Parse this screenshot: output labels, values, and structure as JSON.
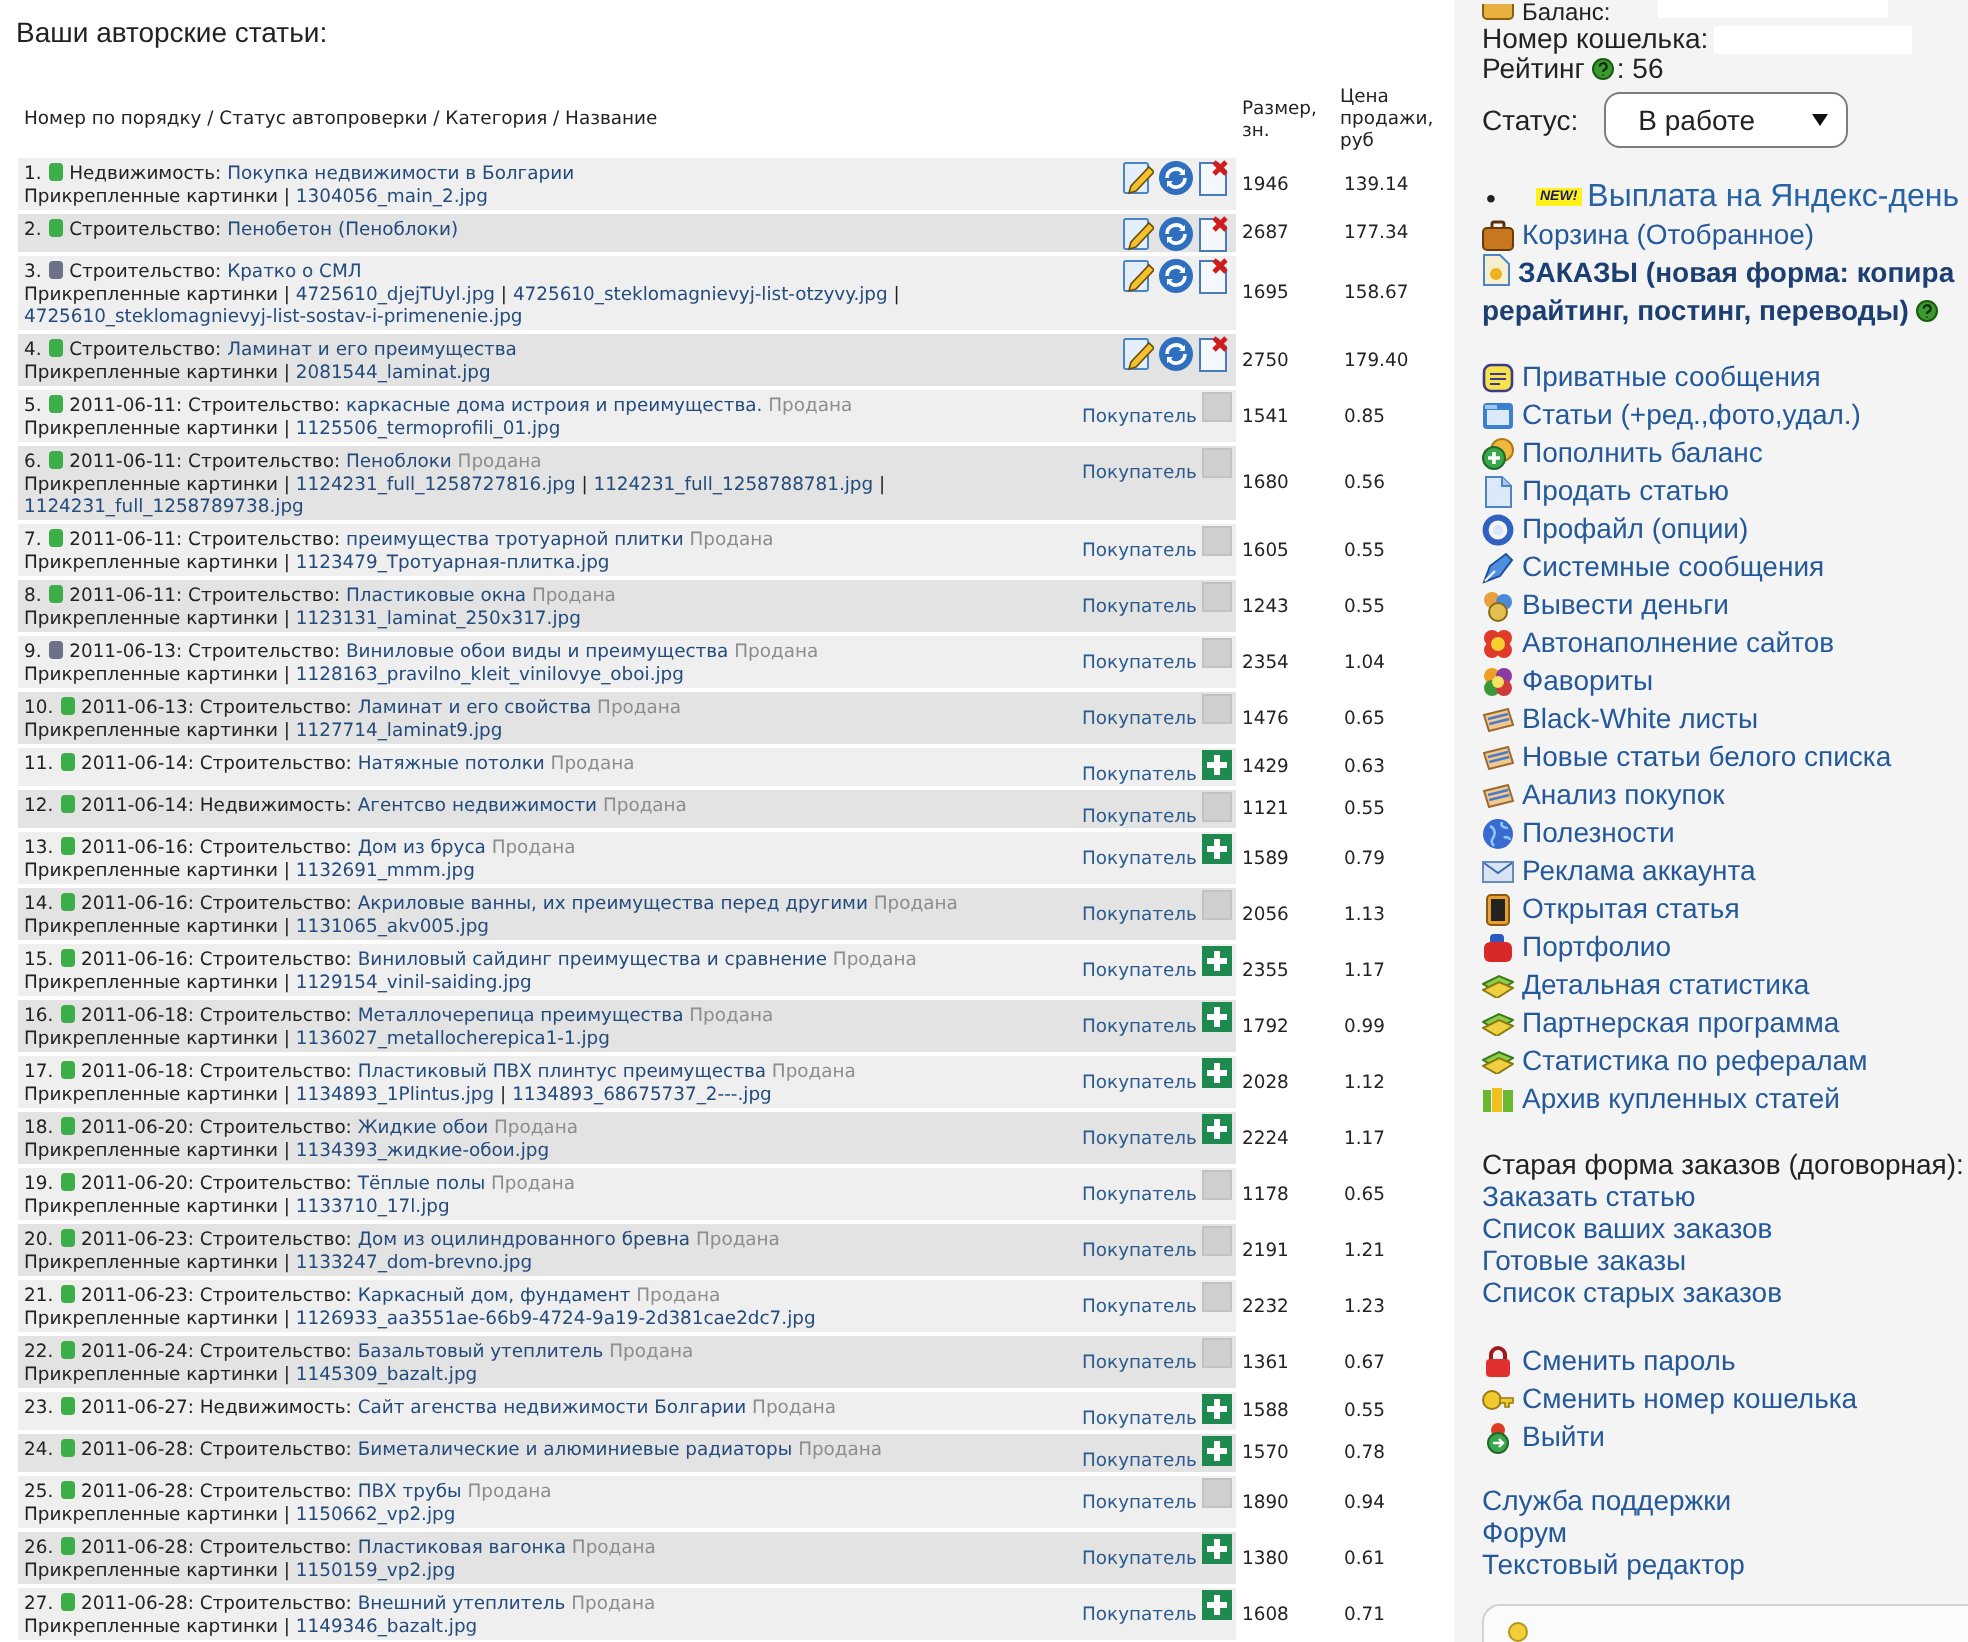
{
  "page_title": "Ваши авторские статьи:",
  "table": {
    "columns": [
      "Номер по порядку / Статус автопроверки / Категория / Название",
      "Размер, зн.",
      "Цена продажи, руб"
    ],
    "rows": [
      {
        "number": "1.",
        "color": "#3cae48",
        "kind": "own",
        "category": "Недвижимость:",
        "title": "Покупка недвижимости в Болгарии",
        "attachments": {
          "label": "Прикрепленные картинки |",
          "files": [
            {
              "name": "1304056_main_2.jpg"
            }
          ]
        },
        "size": "1946",
        "price": "139.14"
      },
      {
        "number": "2.",
        "color": "#3cae48",
        "kind": "own",
        "category": "Строительство:",
        "title": "Пенобетон (Пеноблоки)",
        "size": "2687",
        "price": "177.34"
      },
      {
        "number": "3.",
        "color": "#6d7288",
        "kind": "own",
        "category": "Строительство:",
        "title": "Кратко о СМЛ",
        "attachments": {
          "label": "Прикрепленные картинки |",
          "files": [
            {
              "name": "4725610_djejTUyl.jpg",
              "separator": "|"
            },
            {
              "name": "4725610_steklomagnievyj-list-otzyvy.jpg",
              "separator": "|"
            },
            {
              "name": "4725610_steklomagnievyj-list-sostav-i-primenenie.jpg"
            }
          ]
        },
        "size": "1695",
        "price": "158.67"
      },
      {
        "number": "4.",
        "color": "#3cae48",
        "kind": "own",
        "category": "Строительство:",
        "title": "Ламинат и его преимущества",
        "attachments": {
          "label": "Прикрепленные картинки |",
          "files": [
            {
              "name": "2081544_laminat.jpg"
            }
          ]
        },
        "size": "2750",
        "price": "179.40"
      },
      {
        "number": "5.",
        "color": "#3cae48",
        "kind": "sold",
        "date": "2011-06-11:",
        "category": "Строительство:",
        "title": "каркасные дома истроия и преимущества.",
        "sale_status": "Продана",
        "attachments": {
          "label": "Прикрепленные картинки |",
          "files": [
            {
              "name": "1125506_termoprofili_01.jpg"
            }
          ]
        },
        "buyer": "Покупатель",
        "plus": false,
        "size": "1541",
        "price": "0.85"
      },
      {
        "number": "6.",
        "color": "#3cae48",
        "kind": "sold",
        "date": "2011-06-11:",
        "category": "Строительство:",
        "title": "Пеноблоки",
        "sale_status": "Продана",
        "attachments": {
          "label": "Прикрепленные картинки |",
          "files": [
            {
              "name": "1124231_full_1258727816.jpg",
              "separator": "|"
            },
            {
              "name": "1124231_full_1258788781.jpg",
              "separator": "|"
            },
            {
              "name": "1124231_full_1258789738.jpg"
            }
          ]
        },
        "buyer": "Покупатель",
        "plus": false,
        "size": "1680",
        "price": "0.56"
      },
      {
        "number": "7.",
        "color": "#3cae48",
        "kind": "sold",
        "date": "2011-06-11:",
        "category": "Строительство:",
        "title": "преимущества тротуарной плитки",
        "sale_status": "Продана",
        "attachments": {
          "label": "Прикрепленные картинки |",
          "files": [
            {
              "name": "1123479_Тротуарная-плитка.jpg"
            }
          ]
        },
        "buyer": "Покупатель",
        "plus": false,
        "size": "1605",
        "price": "0.55"
      },
      {
        "number": "8.",
        "color": "#3cae48",
        "kind": "sold",
        "date": "2011-06-11:",
        "category": "Строительство:",
        "title": "Пластиковые окна",
        "sale_status": "Продана",
        "attachments": {
          "label": "Прикрепленные картинки |",
          "files": [
            {
              "name": "1123131_laminat_250x317.jpg"
            }
          ]
        },
        "buyer": "Покупатель",
        "plus": false,
        "size": "1243",
        "price": "0.55"
      },
      {
        "number": "9.",
        "color": "#6d7288",
        "kind": "sold",
        "date": "2011-06-13:",
        "category": "Строительство:",
        "title": "Виниловые обои виды и преимущества",
        "sale_status": "Продана",
        "attachments": {
          "label": "Прикрепленные картинки |",
          "files": [
            {
              "name": "1128163_pravilno_kleit_vinilovye_oboi.jpg"
            }
          ]
        },
        "buyer": "Покупатель",
        "plus": false,
        "size": "2354",
        "price": "1.04"
      },
      {
        "number": "10.",
        "color": "#3cae48",
        "kind": "sold",
        "date": "2011-06-13:",
        "category": "Строительство:",
        "title": "Ламинат и его свойства",
        "sale_status": "Продана",
        "attachments": {
          "label": "Прикрепленные картинки |",
          "files": [
            {
              "name": "1127714_laminat9.jpg"
            }
          ]
        },
        "buyer": "Покупатель",
        "plus": false,
        "size": "1476",
        "price": "0.65"
      },
      {
        "number": "11.",
        "color": "#3cae48",
        "kind": "sold",
        "date": "2011-06-14:",
        "category": "Строительство:",
        "title": "Натяжные потолки",
        "sale_status": "Продана",
        "buyer": "Покупатель",
        "plus": true,
        "size": "1429",
        "price": "0.63"
      },
      {
        "number": "12.",
        "color": "#3cae48",
        "kind": "sold",
        "date": "2011-06-14:",
        "category": "Недвижимость:",
        "title": "Агентсво недвижимости",
        "sale_status": "Продана",
        "buyer": "Покупатель",
        "plus": false,
        "size": "1121",
        "price": "0.55"
      },
      {
        "number": "13.",
        "color": "#3cae48",
        "kind": "sold",
        "date": "2011-06-16:",
        "category": "Строительство:",
        "title": "Дом из бруса",
        "sale_status": "Продана",
        "attachments": {
          "label": "Прикрепленные картинки |",
          "files": [
            {
              "name": "1132691_mmm.jpg"
            }
          ]
        },
        "buyer": "Покупатель",
        "plus": true,
        "size": "1589",
        "price": "0.79"
      },
      {
        "number": "14.",
        "color": "#3cae48",
        "kind": "sold",
        "date": "2011-06-16:",
        "category": "Строительство:",
        "title": "Акриловые ванны, их преимущества перед другими",
        "sale_status": "Продана",
        "attachments": {
          "label": "Прикрепленные картинки |",
          "files": [
            {
              "name": "1131065_akv005.jpg"
            }
          ]
        },
        "buyer": "Покупатель",
        "plus": false,
        "size": "2056",
        "price": "1.13"
      },
      {
        "number": "15.",
        "color": "#3cae48",
        "kind": "sold",
        "date": "2011-06-16:",
        "category": "Строительство:",
        "title": "Виниловый сайдинг преимущества и сравнение",
        "sale_status": "Продана",
        "attachments": {
          "label": "Прикрепленные картинки |",
          "files": [
            {
              "name": "1129154_vinil-saiding.jpg"
            }
          ]
        },
        "buyer": "Покупатель",
        "plus": true,
        "size": "2355",
        "price": "1.17"
      },
      {
        "number": "16.",
        "color": "#3cae48",
        "kind": "sold",
        "date": "2011-06-18:",
        "category": "Строительство:",
        "title": "Металлочерепица преимущества",
        "sale_status": "Продана",
        "attachments": {
          "label": "Прикрепленные картинки |",
          "files": [
            {
              "name": "1136027_metallocherepica1-1.jpg"
            }
          ]
        },
        "buyer": "Покупатель",
        "plus": true,
        "size": "1792",
        "price": "0.99"
      },
      {
        "number": "17.",
        "color": "#3cae48",
        "kind": "sold",
        "date": "2011-06-18:",
        "category": "Строительство:",
        "title": "Пластиковый ПВХ плинтус преимущества",
        "sale_status": "Продана",
        "attachments": {
          "label": "Прикрепленные картинки |",
          "files": [
            {
              "name": "1134893_1Plintus.jpg",
              "separator": "|"
            },
            {
              "name": "1134893_68675737_2---.jpg"
            }
          ]
        },
        "buyer": "Покупатель",
        "plus": true,
        "size": "2028",
        "price": "1.12"
      },
      {
        "number": "18.",
        "color": "#3cae48",
        "kind": "sold",
        "date": "2011-06-20:",
        "category": "Строительство:",
        "title": "Жидкие обои",
        "sale_status": "Продана",
        "attachments": {
          "label": "Прикрепленные картинки |",
          "files": [
            {
              "name": "1134393_жидкие-обои.jpg"
            }
          ]
        },
        "buyer": "Покупатель",
        "plus": true,
        "size": "2224",
        "price": "1.17"
      },
      {
        "number": "19.",
        "color": "#3cae48",
        "kind": "sold",
        "date": "2011-06-20:",
        "category": "Строительство:",
        "title": "Тёплые полы",
        "sale_status": "Продана",
        "attachments": {
          "label": "Прикрепленные картинки |",
          "files": [
            {
              "name": "1133710_17l.jpg"
            }
          ]
        },
        "buyer": "Покупатель",
        "plus": false,
        "size": "1178",
        "price": "0.65"
      },
      {
        "number": "20.",
        "color": "#3cae48",
        "kind": "sold",
        "date": "2011-06-23:",
        "category": "Строительство:",
        "title": "Дом из оцилиндрованного бревна",
        "sale_status": "Продана",
        "attachments": {
          "label": "Прикрепленные картинки |",
          "files": [
            {
              "name": "1133247_dom-brevno.jpg"
            }
          ]
        },
        "buyer": "Покупатель",
        "plus": false,
        "size": "2191",
        "price": "1.21"
      },
      {
        "number": "21.",
        "color": "#3cae48",
        "kind": "sold",
        "date": "2011-06-23:",
        "category": "Строительство:",
        "title": "Каркасный дом, фундамент",
        "sale_status": "Продана",
        "attachments": {
          "label": "Прикрепленные картинки |",
          "files": [
            {
              "name": "1126933_aa3551ae-66b9-4724-9a19-2d381cae2dc7.jpg"
            }
          ]
        },
        "buyer": "Покупатель",
        "plus": false,
        "size": "2232",
        "price": "1.23"
      },
      {
        "number": "22.",
        "color": "#3cae48",
        "kind": "sold",
        "date": "2011-06-24:",
        "category": "Строительство:",
        "title": "Базальтовый утеплитель",
        "sale_status": "Продана",
        "attachments": {
          "label": "Прикрепленные картинки |",
          "files": [
            {
              "name": "1145309_bazalt.jpg"
            }
          ]
        },
        "buyer": "Покупатель",
        "plus": false,
        "size": "1361",
        "price": "0.67"
      },
      {
        "number": "23.",
        "color": "#3cae48",
        "kind": "sold",
        "date": "2011-06-27:",
        "category": "Недвижимость:",
        "title": "Сайт агенства недвижимости Болгарии",
        "sale_status": "Продана",
        "buyer": "Покупатель",
        "plus": true,
        "size": "1588",
        "price": "0.55"
      },
      {
        "number": "24.",
        "color": "#3cae48",
        "kind": "sold",
        "date": "2011-06-28:",
        "category": "Строительство:",
        "title": "Биметалические и алюминиевые радиаторы",
        "sale_status": "Продана",
        "buyer": "Покупатель",
        "plus": true,
        "size": "1570",
        "price": "0.78"
      },
      {
        "number": "25.",
        "color": "#3cae48",
        "kind": "sold",
        "date": "2011-06-28:",
        "category": "Строительство:",
        "title": "ПВХ трубы",
        "sale_status": "Продана",
        "attachments": {
          "label": "Прикрепленные картинки |",
          "files": [
            {
              "name": "1150662_vp2.jpg"
            }
          ]
        },
        "buyer": "Покупатель",
        "plus": false,
        "size": "1890",
        "price": "0.94"
      },
      {
        "number": "26.",
        "color": "#3cae48",
        "kind": "sold",
        "date": "2011-06-28:",
        "category": "Строительство:",
        "title": "Пластиковая вагонка",
        "sale_status": "Продана",
        "attachments": {
          "label": "Прикрепленные картинки |",
          "files": [
            {
              "name": "1150159_vp2.jpg"
            }
          ]
        },
        "buyer": "Покупатель",
        "plus": true,
        "size": "1380",
        "price": "0.61"
      },
      {
        "number": "27.",
        "color": "#3cae48",
        "kind": "sold",
        "date": "2011-06-28:",
        "category": "Строительство:",
        "title": "Внешний утеплитель",
        "sale_status": "Продана",
        "attachments": {
          "label": "Прикрепленные картинки |",
          "files": [
            {
              "name": "1149346_bazalt.jpg"
            }
          ]
        },
        "buyer": "Покупатель",
        "plus": true,
        "size": "1608",
        "price": "0.71"
      }
    ]
  },
  "sidebar": {
    "balance_label": "Баланс:",
    "wallet_label": "Номер кошелька:",
    "rating": {
      "label": "Рейтинг",
      "value": ": 56"
    },
    "status": {
      "label": "Статус:",
      "value": "В работе"
    },
    "promo": {
      "bullet": "•",
      "badge": "NEW!",
      "text": "Выплата на Яндекс-день"
    },
    "basket": "Корзина (Отобранное)",
    "orders": {
      "lines": [
        "ЗАКАЗЫ (новая форма: копира",
        "рерайтинг, постинг, переводы)"
      ]
    },
    "menu": [
      "Приватные сообщения",
      "Статьи (+ред.,фото,удал.)",
      "Пополнить баланс",
      "Продать статью",
      "Профайл (опции)",
      "Системные сообщения",
      "Вывести деньги",
      "Автонаполнение сайтов",
      "Фавориты",
      "Black-White листы",
      "Новые статьи белого списка",
      "Анализ покупок",
      "Полезности",
      "Реклама аккаунта",
      "Открытая статья",
      "Портфолио",
      "Детальная статистика",
      "Партнерская программа",
      "Статистика по рефералам",
      "Архив купленных статей"
    ],
    "old_orders": {
      "title": "Старая форма заказов (договорная):",
      "links": [
        "Заказать статью",
        "Список ваших заказов",
        "Готовые заказы",
        "Список старых заказов"
      ]
    },
    "account": [
      "Сменить пароль",
      "Сменить номер кошелька",
      "Выйти"
    ],
    "help": [
      "Служба поддержки",
      "Форум",
      "Текстовый редактор"
    ]
  }
}
